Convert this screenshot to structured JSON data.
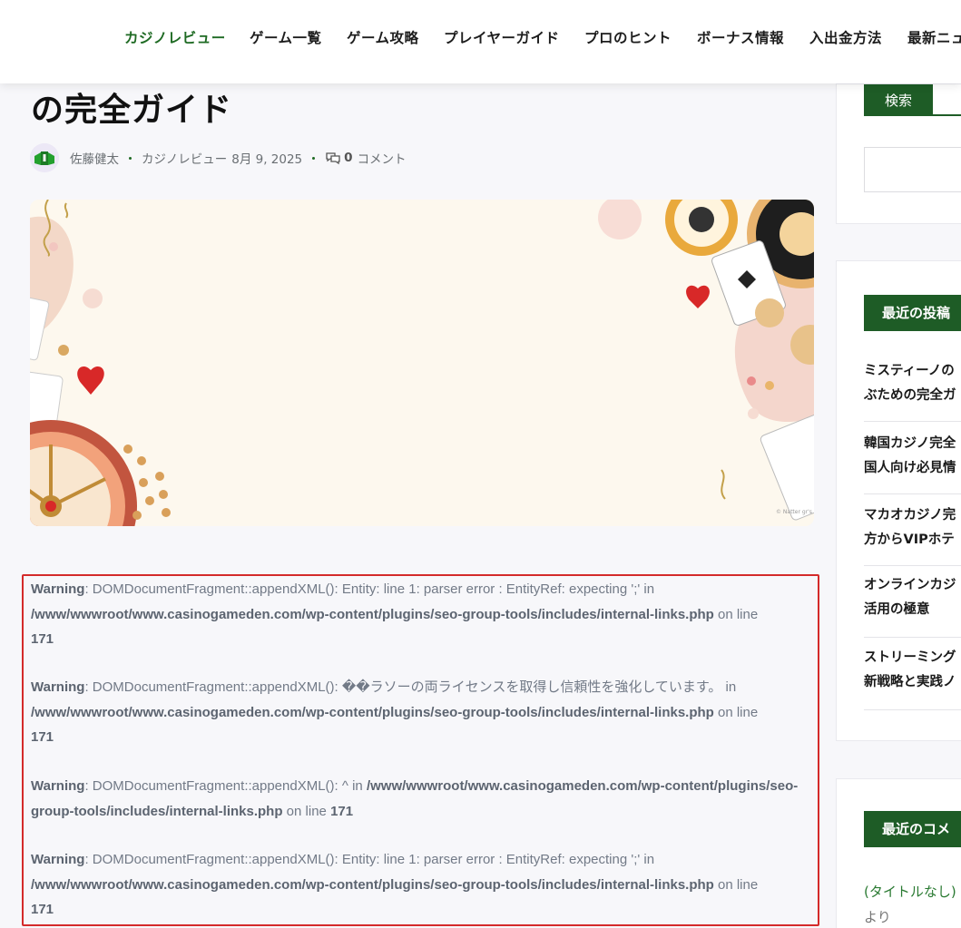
{
  "nav": {
    "items": [
      {
        "label": "カジノレビュー",
        "active": true
      },
      {
        "label": "ゲーム一覧",
        "active": false
      },
      {
        "label": "ゲーム攻略",
        "active": false
      },
      {
        "label": "プレイヤーガイド",
        "active": false
      },
      {
        "label": "プロのヒント",
        "active": false
      },
      {
        "label": "ボーナス情報",
        "active": false
      },
      {
        "label": "入出金方法",
        "active": false
      },
      {
        "label": "最新ニュ",
        "active": false
      }
    ]
  },
  "post": {
    "title_fragment": "の完全ガイド",
    "author": "佐藤健太",
    "category": "カジノレビュー",
    "date": "8月 9, 2025",
    "comment_count": "0",
    "comment_label": "コメント",
    "image_watermark": "© Natter gr's"
  },
  "warnings": [
    {
      "label": "Warning",
      "message": ": DOMDocumentFragment::appendXML(): Entity: line 1: parser error : EntityRef: expecting ';' in",
      "path": "/www/wwwroot/www.casinogameden.com/wp-content/plugins/seo-group-tools/includes/internal-links.php",
      "on_line": " on line",
      "line": "171"
    },
    {
      "label": "Warning",
      "message": ": DOMDocumentFragment::appendXML(): ��ラソーの両ライセンスを取得し信頼性を強化しています。 in",
      "path": "/www/wwwroot/www.casinogameden.com/wp-content/plugins/seo-group-tools/includes/internal-links.php",
      "on_line": " on line",
      "line": "171"
    },
    {
      "label": "Warning",
      "message": ": DOMDocumentFragment::appendXML(): ^ in ",
      "path": "/www/wwwroot/www.casinogameden.com/wp-content/plugins/seo-group-tools/includes/internal-links.php",
      "on_line": " on line ",
      "line": "171"
    },
    {
      "label": "Warning",
      "message": ": DOMDocumentFragment::appendXML(): Entity: line 1: parser error : EntityRef: expecting ';' in",
      "path": "/www/wwwroot/www.casinogameden.com/wp-content/plugins/seo-group-tools/includes/internal-links.php",
      "on_line": " on line",
      "line": "171"
    }
  ],
  "sidebar": {
    "search_button": "検索",
    "search_value": "",
    "recent_posts_heading": "最近の投稿",
    "recent_posts": [
      {
        "line1": "ミスティーノの",
        "line2": "ぶための完全ガ"
      },
      {
        "line1": "韓国カジノ完全",
        "line2": "国人向け必見情"
      },
      {
        "line1": "マカオカジノ完",
        "line2": "方からVIPホテ"
      },
      {
        "line1": "オンラインカジ",
        "line2": "活用の極意"
      },
      {
        "line1": "ストリーミング",
        "line2": "新戦略と実践ノ"
      }
    ],
    "recent_comments_heading": "最近のコメ",
    "recent_comment_link": "(タイトルなし)",
    "recent_comment_suffix": "より"
  },
  "colors": {
    "accent_green": "#1e5c26",
    "active_nav": "#1e6a23",
    "warning_border": "#d42a2a",
    "warning_text": "#727a87"
  }
}
